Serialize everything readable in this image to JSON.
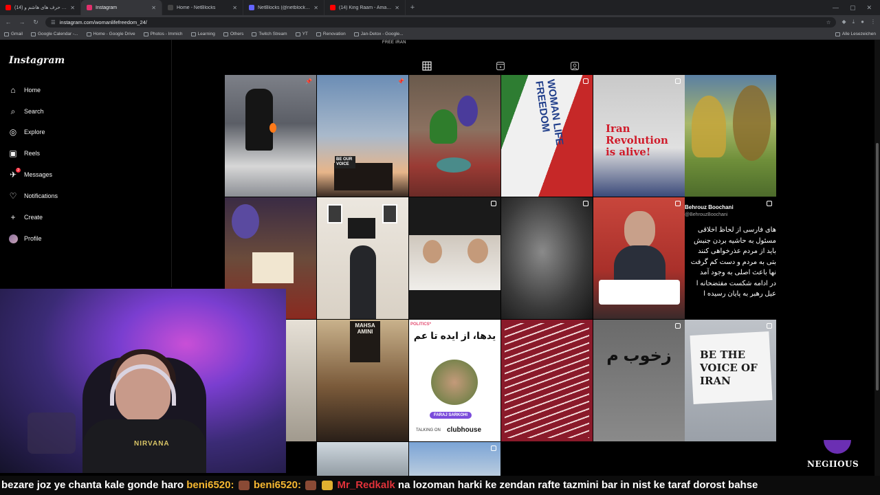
{
  "browser": {
    "tabs": [
      {
        "label": "(14) پاکتش به حرف های هاشم و",
        "favicon_color": "#ff0000",
        "active": false
      },
      {
        "label": "Instagram",
        "favicon_color": "#e1306c",
        "active": true
      },
      {
        "label": "Home - NetBlocks",
        "favicon_color": "#333333",
        "active": false
      },
      {
        "label": "NetBlocks (@netblocks@mastodon)",
        "favicon_color": "#6364ff",
        "active": false
      },
      {
        "label": "(14) King Raam - Ama To Nisti",
        "favicon_color": "#ff0000",
        "active": false
      }
    ],
    "url": "instagram.com/womanlifefreedom_24/",
    "bookmarks": [
      "Gmail",
      "Google Calendar -...",
      "Home - Google Drive",
      "Photos - Immich",
      "Learning",
      "Others",
      "Twitch Stream",
      "YT",
      "Renovation",
      "Jan-Detox - Google..."
    ],
    "bookmarks_right": "Alle Lesezeichen"
  },
  "sidebar": {
    "logo": "Instagram",
    "items": [
      {
        "label": "Home",
        "icon": "home-icon",
        "glyph": "⌂"
      },
      {
        "label": "Search",
        "icon": "search-icon",
        "glyph": "⌕"
      },
      {
        "label": "Explore",
        "icon": "compass-icon",
        "glyph": "◎"
      },
      {
        "label": "Reels",
        "icon": "reels-icon",
        "glyph": "▣"
      },
      {
        "label": "Messages",
        "icon": "messenger-icon",
        "glyph": "✈",
        "badge": "2"
      },
      {
        "label": "Notifications",
        "icon": "heart-icon",
        "glyph": "♡"
      },
      {
        "label": "Create",
        "icon": "plus-icon",
        "glyph": "+"
      },
      {
        "label": "Profile",
        "icon": "avatar-icon",
        "glyph": ""
      }
    ]
  },
  "profile": {
    "caption": "FREE IRAN"
  },
  "posts": {
    "texts": {
      "be_our_voice": "BE OUR VOICE",
      "woman_life_freedom": "WOMAN LIFE FREEDOM",
      "iran_revolution": "Iran Revolution is alive!",
      "tweet_user": "Behrouz Boochani",
      "tweet_handle": "@BehrouzBoochani",
      "tweet_lines": [
        "های فارسی از لحاظ اخلاقی",
        "مسئول به حاشیه بردن جنبش",
        "باید از مردم عذرخواهی کنند",
        "بتی به مردم و دست کم گرفت",
        "نها باعث اصلی به وجود آمد",
        "در ادامه شکست مفتضحانه ا",
        "عیل رهبر به پایان رسیده ا"
      ],
      "mahsa_amini": "MAHSA AMINI",
      "politics": "POLITICS*",
      "persian_headline": "یدها، از ایده تا عم",
      "faraj": "FARAJ SARKOHI",
      "talking_on": "TALKING ON",
      "clubhouse": "clubhouse",
      "be_the_voice": "BE THE VOICE OF IRAN",
      "graffiti": "زخوب م"
    }
  },
  "chat_ticker": {
    "msg1": "bezare joz ye chanta kale gonde haro",
    "user1": "beni6520:",
    "user2": "beni6520:",
    "user3": "Mr_Redkalk",
    "msg2": "na lozoman harki ke zendan rafte tazmini bar in nist ke taraf dorost bahse"
  },
  "brand": {
    "name": "NEGIIOUS"
  }
}
